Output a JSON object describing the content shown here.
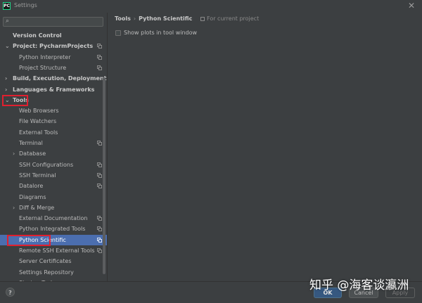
{
  "window": {
    "app_icon": "PC",
    "title": "Settings",
    "close": "✕"
  },
  "search": {
    "icon": "search-icon",
    "glyph": "⌕",
    "value": "",
    "placeholder": ""
  },
  "sidebar": {
    "items": [
      {
        "label": "Version Control",
        "bold": true
      },
      {
        "label": "Project: PycharmProjects",
        "bold": true,
        "arrow": "⌄"
      },
      {
        "label": "Python Interpreter"
      },
      {
        "label": "Project Structure"
      },
      {
        "label": "Build, Execution, Deployment",
        "bold": true,
        "arrow": "›"
      },
      {
        "label": "Languages & Frameworks",
        "bold": true,
        "arrow": "›"
      },
      {
        "label": "Tools",
        "bold": true,
        "arrow": "⌄"
      },
      {
        "label": "Web Browsers"
      },
      {
        "label": "File Watchers"
      },
      {
        "label": "External Tools"
      },
      {
        "label": "Terminal"
      },
      {
        "label": "Database",
        "arrow": "›"
      },
      {
        "label": "SSH Configurations"
      },
      {
        "label": "SSH Terminal"
      },
      {
        "label": "Datalore"
      },
      {
        "label": "Diagrams"
      },
      {
        "label": "Diff & Merge",
        "arrow": "›"
      },
      {
        "label": "External Documentation"
      },
      {
        "label": "Python Integrated Tools"
      },
      {
        "label": "Python Scientific",
        "selected": true
      },
      {
        "label": "Remote SSH External Tools"
      },
      {
        "label": "Server Certificates"
      },
      {
        "label": "Settings Repository"
      },
      {
        "label": "Startup Tasks"
      }
    ]
  },
  "breadcrumb": {
    "parent": "Tools",
    "separator": "›",
    "current": "Python Scientific"
  },
  "scope": {
    "icon": "project-scope-icon",
    "label": "For current project"
  },
  "options": {
    "show_plots": {
      "label": "Show plots in tool window",
      "checked": false
    }
  },
  "buttons": {
    "help": "?",
    "ok": "OK",
    "cancel": "Cancel",
    "apply": "Apply"
  },
  "watermark": "知乎 @海客谈瀛洲",
  "colors": {
    "background": "#3c3f41",
    "selection": "#4b6eaf",
    "highlight_box": "#e0202f",
    "ok_button": "#365880"
  }
}
